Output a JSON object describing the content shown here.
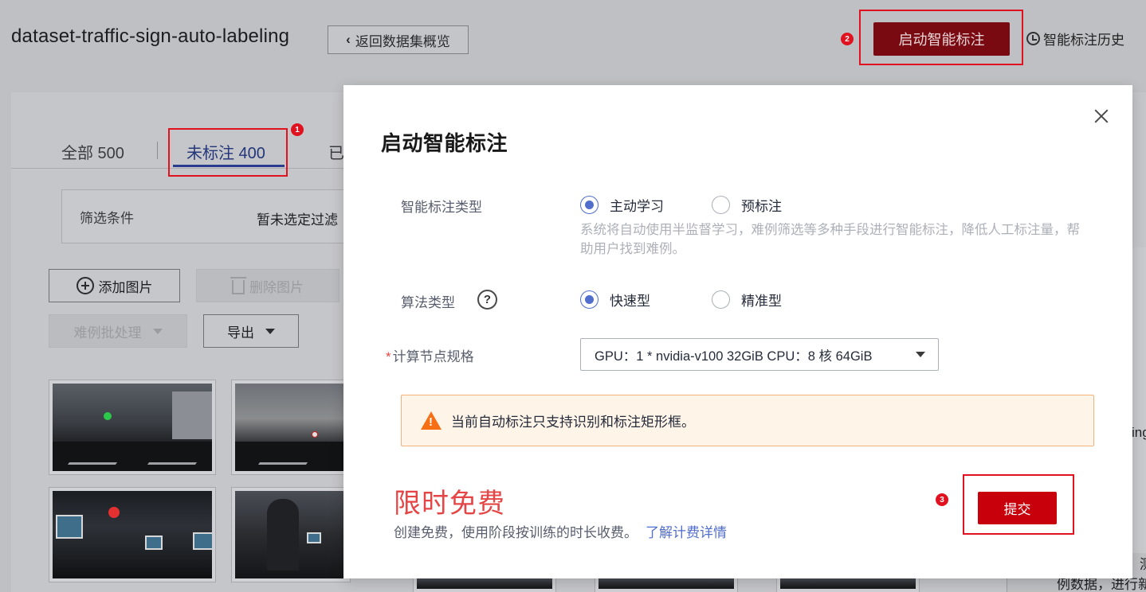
{
  "page": {
    "title": "dataset-traffic-sign-auto-labeling",
    "back_button": "返回数据集概览",
    "start_button": "启动智能标注",
    "history_link": "智能标注历史"
  },
  "tabs": [
    {
      "label": "全部 500"
    },
    {
      "label": "未标注 400"
    },
    {
      "label": "已"
    }
  ],
  "filter": {
    "label": "筛选条件",
    "value": "暂未选定过滤"
  },
  "toolbar": {
    "add_images": "添加图片",
    "delete_images": "删除图片",
    "hard_example": "难例批处理",
    "export": "导出"
  },
  "right_edge": {
    "strip_text": "ing",
    "card_line1": "测",
    "card_line2": "例数据，进行新"
  },
  "annotations": [
    "1",
    "2",
    "3"
  ],
  "modal": {
    "title": "启动智能标注",
    "label_type": {
      "label": "智能标注类型",
      "options": [
        "主动学习",
        "预标注"
      ],
      "selected": "主动学习",
      "help": "系统将自动使用半监督学习，难例筛选等多种手段进行智能标注，降低人工标注量，帮助用户找到难例。"
    },
    "algorithm": {
      "label": "算法类型",
      "options": [
        "快速型",
        "精准型"
      ],
      "selected": "快速型"
    },
    "compute_spec": {
      "required_mark": "*",
      "label": "计算节点规格",
      "value": "GPU：1 * nvidia-v100 32GiB CPU：8 核 64GiB"
    },
    "alert": "当前自动标注只支持识别和标注矩形框。",
    "promo_title": "限时免费",
    "promo_sub": "创建免费，使用阶段按训练的时长收费。",
    "pricing_link": "了解计费详情",
    "submit": "提交"
  },
  "colors": {
    "primary_red": "#c7000b",
    "radio_blue": "#526ecc",
    "annotation_red": "#e0121f",
    "warning_orange": "#f66f15"
  }
}
